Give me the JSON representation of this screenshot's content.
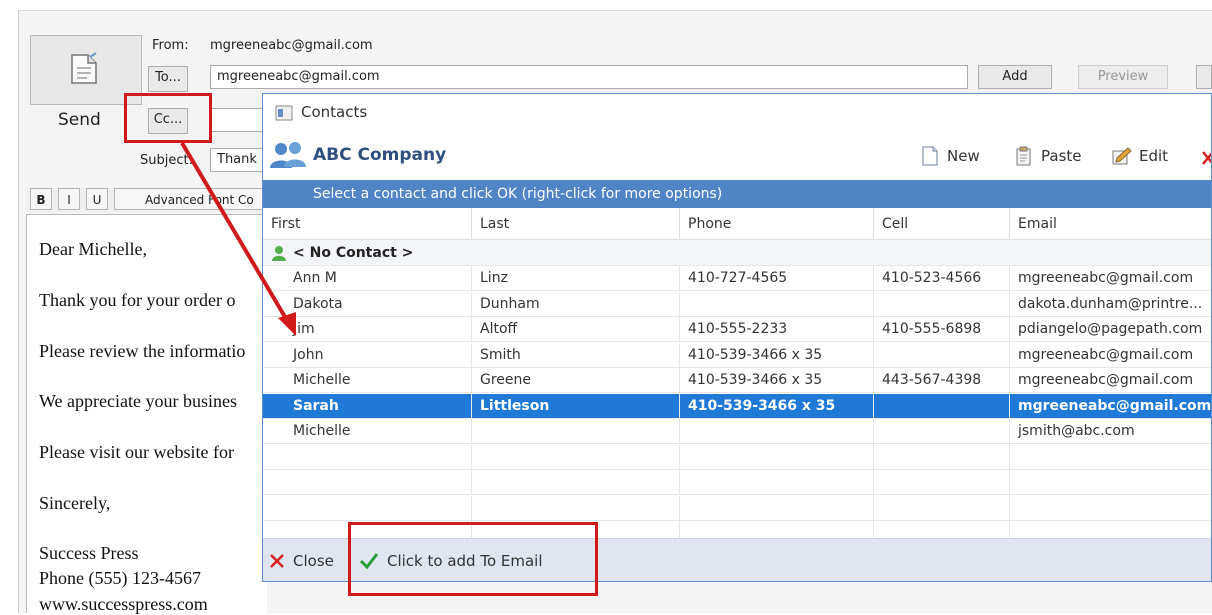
{
  "compose": {
    "from_label": "From:",
    "from_value": "mgreeneabc@gmail.com",
    "to_button": "To...",
    "to_value": "mgreeneabc@gmail.com",
    "cc_button": "Cc...",
    "subject_label": "Subject:",
    "subject_value": "Thank",
    "send_label": "Send",
    "add_button": "Add",
    "preview_button": "Preview",
    "format_buttons": [
      "B",
      "I",
      "U"
    ],
    "advanced_font": "Advanced Font Co",
    "body_lines": [
      "Dear Michelle,",
      "Thank you for your order o",
      "Please review the informatio",
      "We appreciate your busines",
      "Please visit our website for",
      "Sincerely,",
      "Success Press",
      "Phone (555) 123-4567",
      "www.successpress.com"
    ]
  },
  "dialog": {
    "title": "Contacts",
    "company": "ABC Company",
    "toolbar": {
      "new": "New",
      "paste": "Paste",
      "edit": "Edit"
    },
    "banner": "Select a contact and click OK  (right-click for more options)",
    "columns": [
      "First",
      "Last",
      "Phone",
      "Cell",
      "Email"
    ],
    "no_contact": "< No Contact >",
    "rows": [
      {
        "first": "Ann M",
        "last": "Linz",
        "phone": "410-727-4565",
        "cell": "410-523-4566",
        "email": "mgreeneabc@gmail.com"
      },
      {
        "first": "Dakota",
        "last": "Dunham",
        "phone": "",
        "cell": "",
        "email": "dakota.dunham@printre..."
      },
      {
        "first": "Jim",
        "last": "Altoff",
        "phone": "410-555-2233",
        "cell": "410-555-6898",
        "email": "pdiangelo@pagepath.com"
      },
      {
        "first": "John",
        "last": "Smith",
        "phone": "410-539-3466 x 35",
        "cell": "",
        "email": "mgreeneabc@gmail.com"
      },
      {
        "first": "Michelle",
        "last": "Greene",
        "phone": "410-539-3466 x 35",
        "cell": "443-567-4398",
        "email": "mgreeneabc@gmail.com"
      },
      {
        "first": "Sarah",
        "last": "Littleson",
        "phone": "410-539-3466 x 35",
        "cell": "",
        "email": "mgreeneabc@gmail.com"
      },
      {
        "first": "Michelle",
        "last": "",
        "phone": "",
        "cell": "",
        "email": "jsmith@abc.com"
      }
    ],
    "selected_row": 5,
    "close_label": "Close",
    "add_label": "Click to add To Email"
  },
  "colors": {
    "banner": "#4f84c6",
    "selection": "#1e7ad6",
    "highlight": "#d11a1a",
    "check": "#2e9e3a",
    "close_x": "#d62020"
  },
  "icons": [
    "document-send-icon",
    "contacts-window-icon",
    "people-group-icon",
    "new-document-icon",
    "paste-icon",
    "edit-icon",
    "person-icon",
    "close-x-icon",
    "checkmark-icon"
  ]
}
